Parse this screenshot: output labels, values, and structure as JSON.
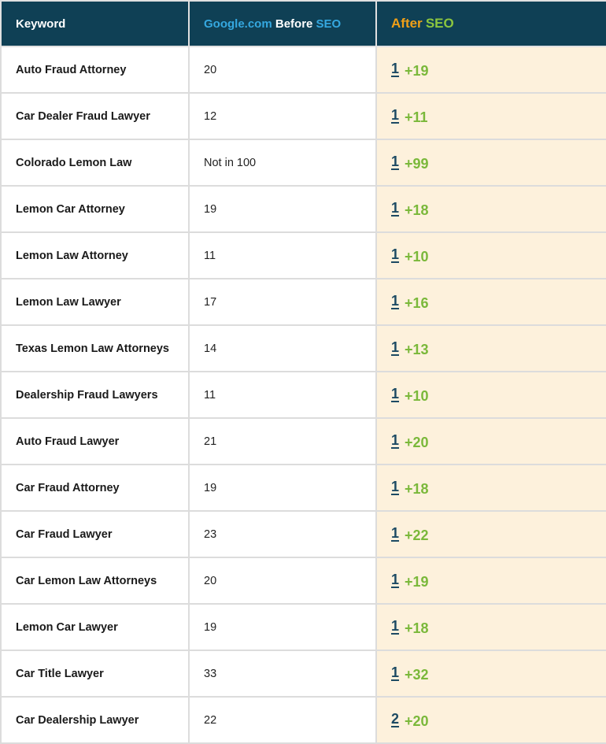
{
  "header": {
    "keyword": "Keyword",
    "before_part1": "Google.com",
    "before_part2": "Before",
    "before_part3": "SEO",
    "after_part1": "After",
    "after_part2": "SEO"
  },
  "colors": {
    "header_bg": "#0f4055",
    "after_bg": "#fdf1dc",
    "blue": "#35a8e0",
    "orange": "#f0a017",
    "green": "#8cc63f",
    "rank": "#1c4a63"
  },
  "rows": [
    {
      "keyword": "Auto Fraud Attorney",
      "before": "20",
      "after": "1",
      "gain": "+19"
    },
    {
      "keyword": "Car Dealer Fraud Lawyer",
      "before": "12",
      "after": "1",
      "gain": "+11"
    },
    {
      "keyword": "Colorado Lemon Law",
      "before": "Not in 100",
      "after": "1",
      "gain": "+99"
    },
    {
      "keyword": "Lemon Car Attorney",
      "before": "19",
      "after": "1",
      "gain": "+18"
    },
    {
      "keyword": "Lemon Law Attorney",
      "before": "11",
      "after": "1",
      "gain": "+10"
    },
    {
      "keyword": "Lemon Law Lawyer",
      "before": "17",
      "after": "1",
      "gain": "+16"
    },
    {
      "keyword": "Texas Lemon Law Attorneys",
      "before": "14",
      "after": "1",
      "gain": "+13"
    },
    {
      "keyword": "Dealership Fraud Lawyers",
      "before": "11",
      "after": "1",
      "gain": "+10"
    },
    {
      "keyword": "Auto Fraud Lawyer",
      "before": "21",
      "after": "1",
      "gain": "+20"
    },
    {
      "keyword": "Car Fraud Attorney",
      "before": "19",
      "after": "1",
      "gain": "+18"
    },
    {
      "keyword": "Car Fraud Lawyer",
      "before": "23",
      "after": "1",
      "gain": "+22"
    },
    {
      "keyword": "Car Lemon Law Attorneys",
      "before": "20",
      "after": "1",
      "gain": "+19"
    },
    {
      "keyword": "Lemon Car Lawyer",
      "before": "19",
      "after": "1",
      "gain": "+18"
    },
    {
      "keyword": "Car Title Lawyer",
      "before": "33",
      "after": "1",
      "gain": "+32"
    },
    {
      "keyword": "Car Dealership Lawyer",
      "before": "22",
      "after": "2",
      "gain": "+20"
    }
  ]
}
